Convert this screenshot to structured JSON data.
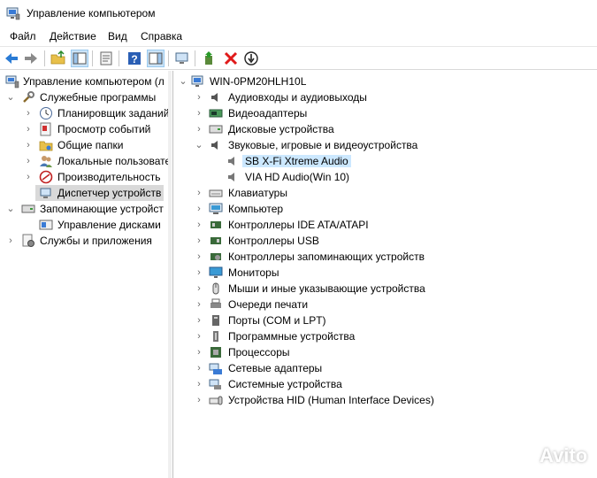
{
  "window": {
    "title": "Управление компьютером"
  },
  "menu": {
    "items": [
      "Файл",
      "Действие",
      "Вид",
      "Справка"
    ]
  },
  "left_tree": {
    "root": "Управление компьютером (л",
    "utilities": "Служебные программы",
    "utilities_children": [
      "Планировщик заданий",
      "Просмотр событий",
      "Общие папки",
      "Локальные пользовате",
      "Производительность",
      "Диспетчер устройств"
    ],
    "storage": "Запоминающие устройст",
    "storage_children": [
      "Управление дисками"
    ],
    "services": "Службы и приложения"
  },
  "device_tree": {
    "computer_name": "WIN-0PM20HLH10L",
    "categories": [
      "Аудиовходы и аудиовыходы",
      "Видеоадаптеры",
      "Дисковые устройства",
      "Звуковые, игровые и видеоустройства",
      "Клавиатуры",
      "Компьютер",
      "Контроллеры IDE ATA/ATAPI",
      "Контроллеры USB",
      "Контроллеры запоминающих устройств",
      "Мониторы",
      "Мыши и иные указывающие устройства",
      "Очереди печати",
      "Порты (COM и LPT)",
      "Программные устройства",
      "Процессоры",
      "Сетевые адаптеры",
      "Системные устройства",
      "Устройства HID (Human Interface Devices)"
    ],
    "sound_children": [
      "SB X-Fi Xtreme Audio",
      "VIA HD Audio(Win 10)"
    ]
  },
  "watermark": {
    "text": "Avito"
  },
  "colors": {
    "selection": "#cce8ff",
    "accent": "#0078d7"
  }
}
